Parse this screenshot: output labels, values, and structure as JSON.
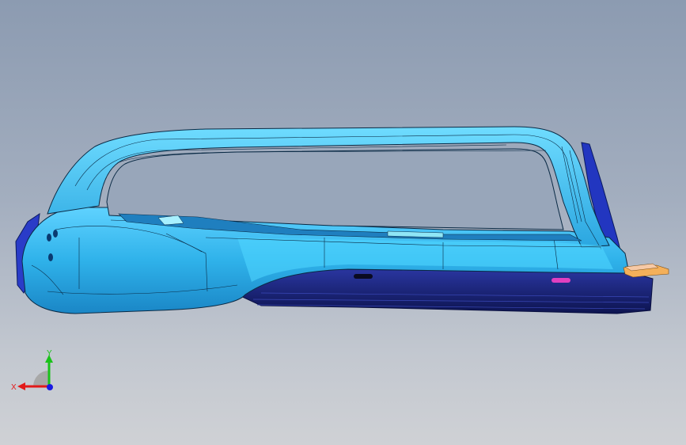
{
  "viewport": {
    "background_top": "#8c9bb1",
    "background_bottom": "#cfd1d5"
  },
  "model": {
    "body_color": "#33b8ee",
    "highlight_color": "#7fe0ff",
    "edge_color": "#0a2a45",
    "dark_panel_color": "#16206a",
    "accent_pink": "#e040c0",
    "accent_orange": "#f4b05a"
  },
  "triad": {
    "x_label": "X",
    "y_label": "Y",
    "x_color": "#e21a1a",
    "y_color": "#1ac21a",
    "z_color": "#1a1ae2"
  }
}
